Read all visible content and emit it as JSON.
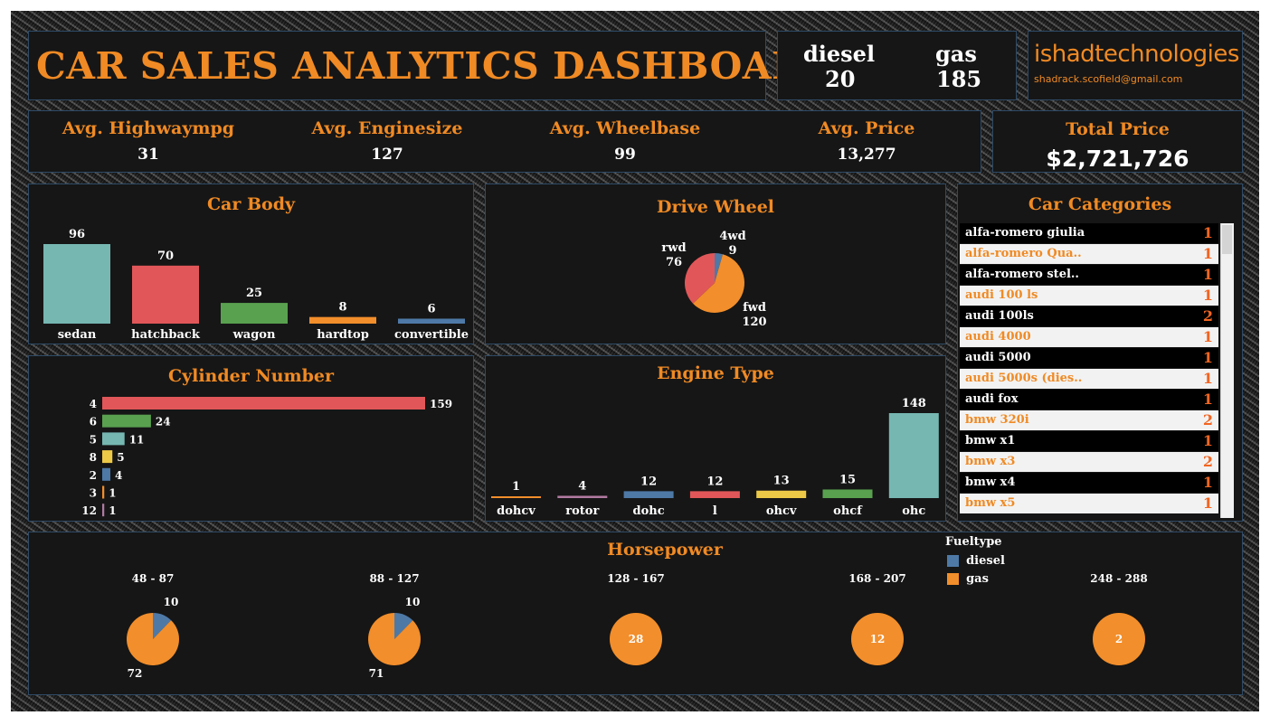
{
  "header": {
    "title": "CAR SALES ANALYTICS DASHBOARD"
  },
  "fuel_summary": [
    {
      "label": "diesel",
      "value": "20"
    },
    {
      "label": "gas",
      "value": "185"
    }
  ],
  "brand": {
    "name": "ishadtechnologies",
    "email": "shadrack.scofield@gmail.com"
  },
  "kpis": [
    {
      "label": "Avg. Highwaympg",
      "value": "31"
    },
    {
      "label": "Avg. Enginesize",
      "value": "127"
    },
    {
      "label": "Avg. Wheelbase",
      "value": "99"
    },
    {
      "label": "Avg. Price",
      "value": "13,277"
    }
  ],
  "total_price": {
    "label": "Total Price",
    "value": "$2,721,726"
  },
  "colors": {
    "orange": "#f08a24",
    "teal": "#76b7b2",
    "red": "#e15759",
    "green": "#59a14f",
    "blue": "#4e79a7",
    "yellow": "#edc948",
    "pink": "#b07aa1",
    "panel": "#161616"
  },
  "categories_panel": {
    "title": "Car Categories",
    "rows": [
      {
        "name": "alfa-romero giulia",
        "count": "1"
      },
      {
        "name": "alfa-romero Qua..",
        "count": "1"
      },
      {
        "name": "alfa-romero stel..",
        "count": "1"
      },
      {
        "name": "audi 100 ls",
        "count": "1"
      },
      {
        "name": "audi 100ls",
        "count": "2"
      },
      {
        "name": "audi 4000",
        "count": "1"
      },
      {
        "name": "audi 5000",
        "count": "1"
      },
      {
        "name": "audi 5000s (dies..",
        "count": "1"
      },
      {
        "name": "audi fox",
        "count": "1"
      },
      {
        "name": "bmw 320i",
        "count": "2"
      },
      {
        "name": "bmw x1",
        "count": "1"
      },
      {
        "name": "bmw x3",
        "count": "2"
      },
      {
        "name": "bmw x4",
        "count": "1"
      },
      {
        "name": "bmw x5",
        "count": "1"
      }
    ]
  },
  "chart_data": [
    {
      "id": "car_body",
      "type": "bar",
      "title": "Car Body",
      "categories": [
        "sedan",
        "hatchback",
        "wagon",
        "hardtop",
        "convertible"
      ],
      "values": [
        96,
        70,
        25,
        8,
        6
      ],
      "colors": [
        "#76b7b2",
        "#e15759",
        "#59a14f",
        "#f28e2b",
        "#4e79a7"
      ]
    },
    {
      "id": "drive_wheel",
      "type": "pie",
      "title": "Drive Wheel",
      "categories": [
        "4wd",
        "fwd",
        "rwd"
      ],
      "values": [
        9,
        120,
        76
      ],
      "colors": [
        "#4e79a7",
        "#f28e2b",
        "#e15759"
      ]
    },
    {
      "id": "cylinder_number",
      "type": "bar",
      "orientation": "horizontal",
      "title": "Cylinder Number",
      "categories": [
        "4",
        "6",
        "5",
        "8",
        "2",
        "3",
        "12"
      ],
      "values": [
        159,
        24,
        11,
        5,
        4,
        1,
        1
      ],
      "colors": [
        "#e15759",
        "#59a14f",
        "#76b7b2",
        "#edc948",
        "#4e79a7",
        "#f28e2b",
        "#b07aa1"
      ]
    },
    {
      "id": "engine_type",
      "type": "bar",
      "title": "Engine Type",
      "categories": [
        "dohcv",
        "rotor",
        "dohc",
        "l",
        "ohcv",
        "ohcf",
        "ohc"
      ],
      "values": [
        1,
        4,
        12,
        12,
        13,
        15,
        148
      ],
      "colors": [
        "#f28e2b",
        "#b07aa1",
        "#4e79a7",
        "#e15759",
        "#edc948",
        "#59a14f",
        "#76b7b2"
      ]
    },
    {
      "id": "horsepower",
      "type": "pie",
      "title": "Horsepower",
      "legend_title": "Fueltype",
      "series_names": [
        "diesel",
        "gas"
      ],
      "series_colors": [
        "#4e79a7",
        "#f28e2b"
      ],
      "groups": [
        {
          "label": "48 - 87",
          "values": [
            10,
            72
          ]
        },
        {
          "label": "88 - 127",
          "values": [
            10,
            71
          ]
        },
        {
          "label": "128 - 167",
          "values": [
            0,
            28
          ]
        },
        {
          "label": "168 - 207",
          "values": [
            0,
            12
          ]
        },
        {
          "label": "248 - 288",
          "values": [
            0,
            2
          ]
        }
      ]
    }
  ]
}
